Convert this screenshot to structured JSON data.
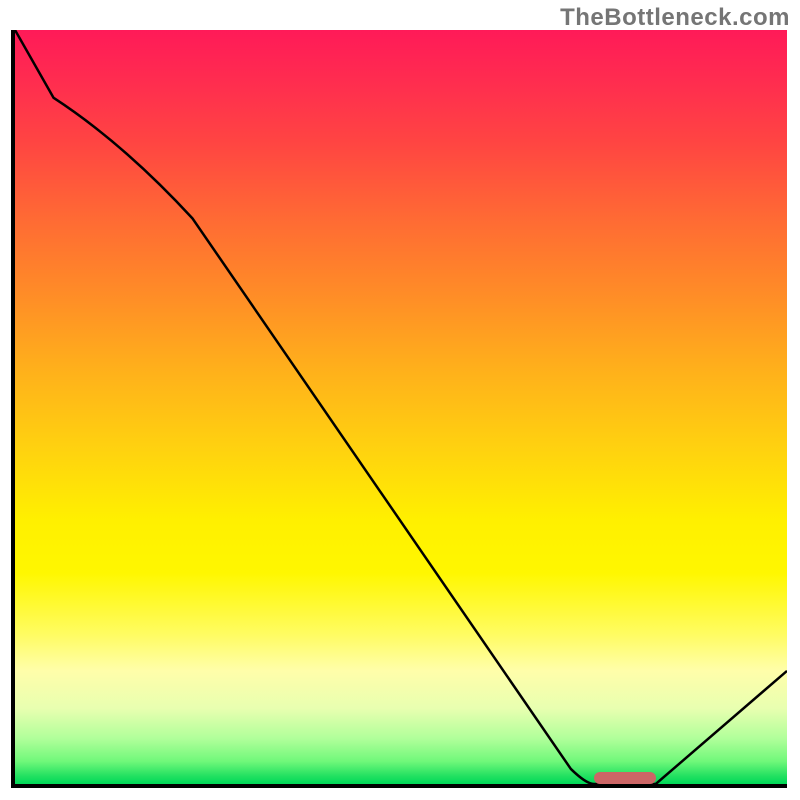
{
  "watermark": "TheBottleneck.com",
  "chart_data": {
    "type": "line",
    "title": "",
    "xlabel": "",
    "ylabel": "",
    "x": [
      0.0,
      0.05,
      0.23,
      0.72,
      0.75,
      0.83,
      1.0
    ],
    "values": [
      1.0,
      0.91,
      0.75,
      0.02,
      0.0,
      0.0,
      0.15
    ],
    "xlim": [
      0,
      1
    ],
    "ylim": [
      0,
      1
    ],
    "grid": false,
    "colors": {
      "gradient_top": "#ff1a58",
      "gradient_mid": "#fff000",
      "gradient_bottom": "#00d858",
      "line": "#000000",
      "marker": "#cc6666"
    },
    "marker": {
      "x_start": 0.75,
      "x_end": 0.83,
      "y": 0.0
    },
    "annotations": []
  },
  "plot": {
    "inner_w": 772,
    "inner_h": 754
  }
}
